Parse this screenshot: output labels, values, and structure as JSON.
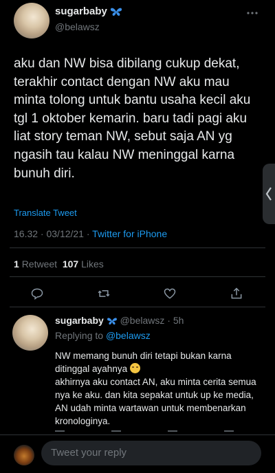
{
  "tweet": {
    "display_name": "sugarbaby",
    "handle": "@belawsz",
    "body": "aku dan NW bisa dibilang cukup dekat, terakhir contact dengan NW aku mau minta tolong untuk bantu usaha kecil aku tgl 1 oktober kemarin. baru tadi pagi aku liat story teman NW, sebut saja AN yg ngasih tau kalau NW meninggal karna bunuh diri.",
    "translate_label": "Translate Tweet",
    "time": "16.32 · 03/12/21 · ",
    "source": "Twitter for iPhone",
    "retweets_count": "1",
    "retweets_label": "Retweet",
    "likes_count": "107",
    "likes_label": "Likes"
  },
  "reply": {
    "display_name": "sugarbaby",
    "handle_time": "@belawsz · 5h",
    "replying_to_label": "Replying to",
    "replying_to_handle": "@belawsz",
    "line1": "NW memang bunuh diri tetapi bukan karna ditinggal ayahnya",
    "line2": "akhirnya aku contact AN, aku minta cerita semua nya ke aku. dan kita sepakat untuk up ke media, AN udah minta wartawan untuk membenarkan kronologinya."
  },
  "composer": {
    "placeholder": "Tweet your reply"
  },
  "icons": {
    "verified": "butterfly-icon",
    "more": "more-icon",
    "reply": "reply-icon",
    "retweet": "retweet-icon",
    "like": "heart-icon",
    "share": "share-icon",
    "side": "chevron-left-icon"
  },
  "colors": {
    "accent": "#1d9bf0",
    "background": "#000000",
    "muted": "#71767b"
  }
}
